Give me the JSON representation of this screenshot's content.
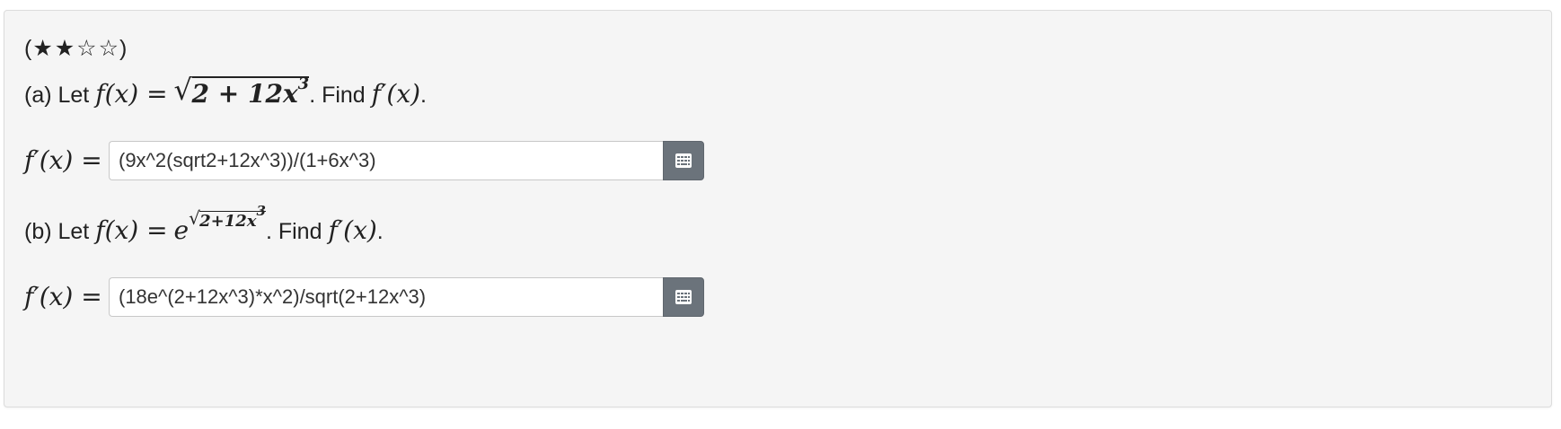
{
  "difficulty": {
    "open": "(",
    "stars": [
      "★",
      "★",
      "☆",
      "☆"
    ],
    "close": ")",
    "filled_count": 2,
    "total": 4
  },
  "part_a": {
    "prefix": "(a) Let",
    "function_lhs": "f(x) =",
    "radicand": "2 + 12x",
    "exponent": "3",
    "suffix_text": ". Find",
    "target": "f′(x)",
    "end": ".",
    "answer_label": "f′(x) =",
    "answer_value": "(9x^2(sqrt2+12x^3))/(1+6x^3)",
    "button_icon": "keypad-icon"
  },
  "part_b": {
    "prefix": "(b) Let",
    "function_lhs": "f(x) =",
    "base": "e",
    "radicand": "2+12x",
    "exponent": "3",
    "suffix_text": ". Find",
    "target": "f′(x)",
    "end": ".",
    "answer_label": "f′(x) =",
    "answer_value": "(18e^(2+12x^3)*x^2)/sqrt(2+12x^3)",
    "button_icon": "keypad-icon"
  },
  "colors": {
    "card_background": "#f5f5f5",
    "button_background": "#6b737b",
    "text": "#222222"
  }
}
